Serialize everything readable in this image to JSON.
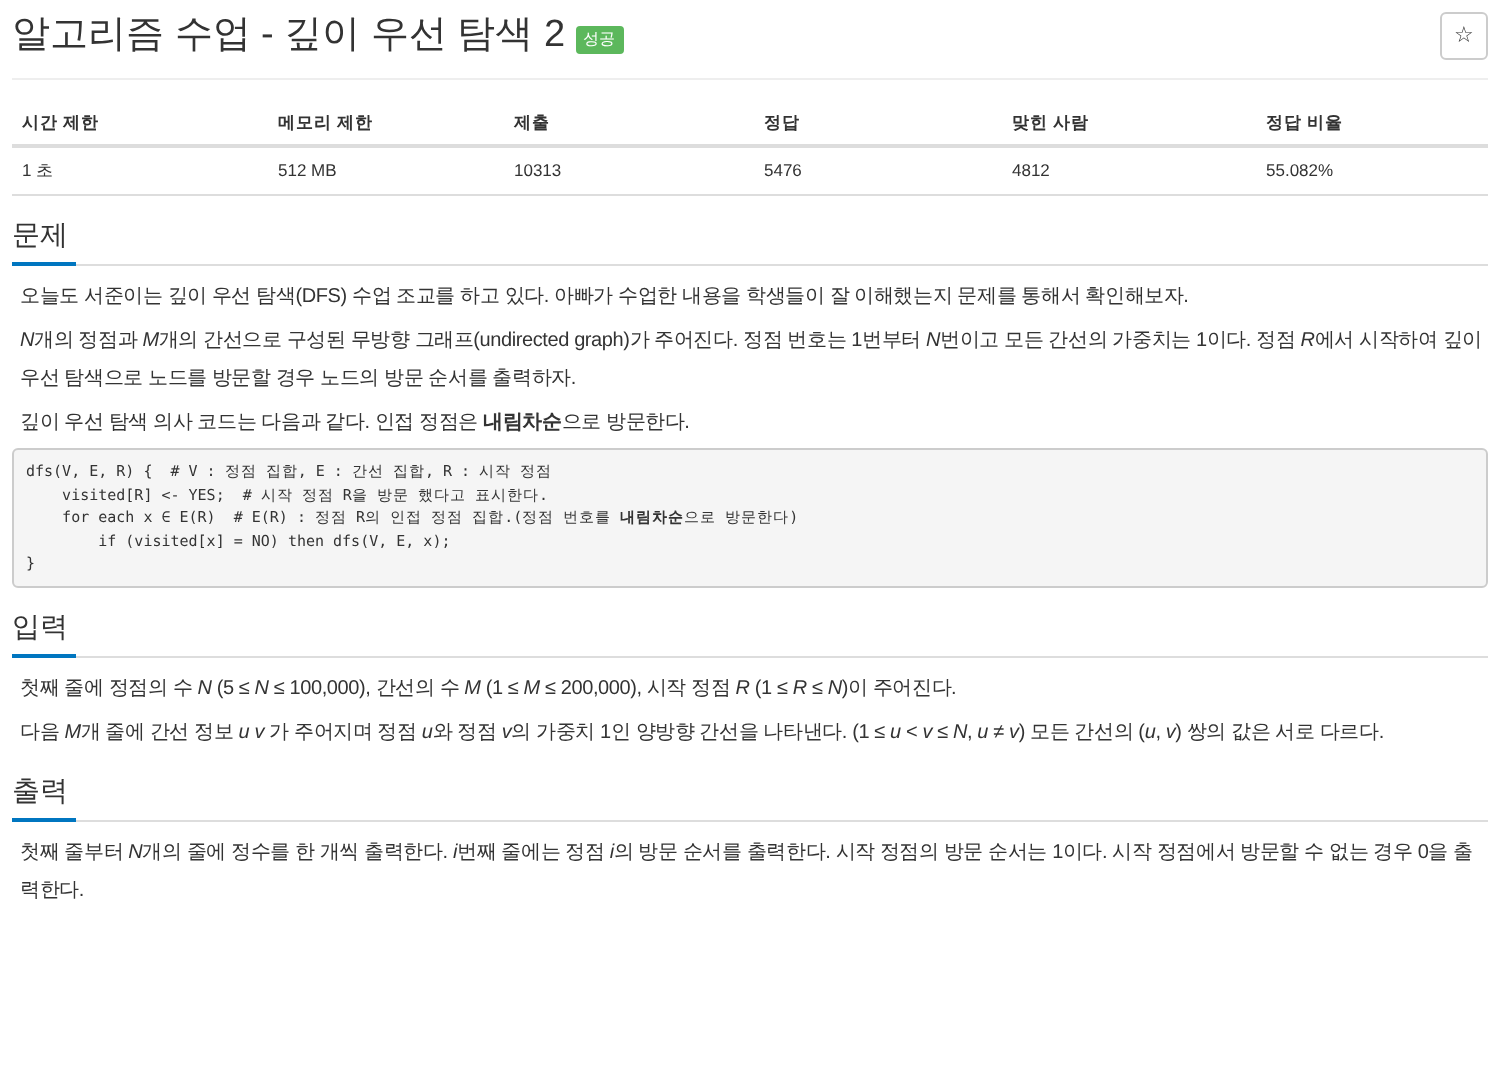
{
  "title": "알고리즘 수업 - 깊이 우선 탐색 2",
  "badge": "성공",
  "star_button": "☆",
  "table": {
    "columns": [
      "시간 제한",
      "메모리 제한",
      "제출",
      "정답",
      "맞힌 사람",
      "정답 비율"
    ],
    "rows": [
      [
        "1 초",
        "512 MB",
        "10313",
        "5476",
        "4812",
        "55.082%"
      ]
    ]
  },
  "sections": [
    {
      "heading": "문제",
      "blocks": [
        {
          "kind": "text",
          "runs": [
            {
              "text": "오늘도 서준이는 깊이 우선 탐색(DFS) 수업 조교를 하고 있다. 아빠가 수업한 내용을 학생들이 잘 이해했는지 문제를 통해서 확인해보자."
            }
          ]
        },
        {
          "kind": "text",
          "runs": [
            {
              "text": "N",
              "italic": true
            },
            {
              "text": "개의 정점과 "
            },
            {
              "text": "M",
              "italic": true
            },
            {
              "text": "개의 간선으로 구성된 무방향 그래프(undirected graph)가 주어진다. 정점 번호는 1번부터 "
            },
            {
              "text": "N",
              "italic": true
            },
            {
              "text": "번이고 모든 간선의 가중치는 1이다. 정점 "
            },
            {
              "text": "R",
              "italic": true
            },
            {
              "text": "에서 시작하여 깊이 우선 탐색으로 노드를 방문할 경우 노드의 방문 순서를 출력하자."
            }
          ]
        },
        {
          "kind": "text",
          "runs": [
            {
              "text": "깊이 우선 탐색 의사 코드는 다음과 같다. 인접 정점은 "
            },
            {
              "text": "내림차순",
              "bold": true
            },
            {
              "text": "으로 방문한다."
            }
          ]
        },
        {
          "kind": "code",
          "lines": [
            "dfs(V, E, R) {  # V : 정점 집합, E : 간선 집합, R : 시작 정점",
            "    visited[R] <- YES;  # 시작 정점 R을 방문 했다고 표시한다.",
            "    for each x ∈ E(R)  # E(R) : 정점 R의 인접 정점 집합.(정점 번호를 **내림차순**으로 방문한다)",
            "        if (visited[x] = NO) then dfs(V, E, x);",
            "}"
          ]
        }
      ]
    },
    {
      "heading": "입력",
      "blocks": [
        {
          "kind": "text",
          "runs": [
            {
              "text": "첫째 줄에 정점의 수 "
            },
            {
              "text": "N",
              "italic": true
            },
            {
              "text": " (5 ≤ "
            },
            {
              "text": "N",
              "italic": true
            },
            {
              "text": " ≤ 100,000), 간선의 수 "
            },
            {
              "text": "M",
              "italic": true
            },
            {
              "text": " (1 ≤ "
            },
            {
              "text": "M",
              "italic": true
            },
            {
              "text": " ≤ 200,000), 시작 정점 "
            },
            {
              "text": "R",
              "italic": true
            },
            {
              "text": " (1 ≤ "
            },
            {
              "text": "R",
              "italic": true
            },
            {
              "text": " ≤ "
            },
            {
              "text": "N",
              "italic": true
            },
            {
              "text": ")이 주어진다."
            }
          ]
        },
        {
          "kind": "text",
          "runs": [
            {
              "text": "다음 "
            },
            {
              "text": "M",
              "italic": true
            },
            {
              "text": "개 줄에 간선 정보 "
            },
            {
              "text": "u v",
              "italic": true
            },
            {
              "text": " 가 주어지며 정점 "
            },
            {
              "text": "u",
              "italic": true
            },
            {
              "text": "와 정점 "
            },
            {
              "text": "v",
              "italic": true
            },
            {
              "text": "의 가중치 1인 양방향 간선을 나타낸다. (1 ≤ "
            },
            {
              "text": "u",
              "italic": true
            },
            {
              "text": " < "
            },
            {
              "text": "v",
              "italic": true
            },
            {
              "text": " ≤ "
            },
            {
              "text": "N",
              "italic": true
            },
            {
              "text": ", "
            },
            {
              "text": "u",
              "italic": true
            },
            {
              "text": " ≠ "
            },
            {
              "text": "v",
              "italic": true
            },
            {
              "text": ") 모든 간선의 ("
            },
            {
              "text": "u",
              "italic": true
            },
            {
              "text": ", "
            },
            {
              "text": "v",
              "italic": true
            },
            {
              "text": ") 쌍의 값은 서로 다르다."
            }
          ]
        }
      ]
    },
    {
      "heading": "출력",
      "blocks": [
        {
          "kind": "text",
          "runs": [
            {
              "text": "첫째 줄부터 "
            },
            {
              "text": "N",
              "italic": true
            },
            {
              "text": "개의 줄에 정수를 한 개씩 출력한다. "
            },
            {
              "text": "i",
              "italic": true
            },
            {
              "text": "번째 줄에는 정점 "
            },
            {
              "text": "i",
              "italic": true
            },
            {
              "text": "의 방문 순서를 출력한다. 시작 정점의 방문 순서는 1이다. 시작 정점에서 방문할 수 없는 경우 0을 출력한다."
            }
          ]
        }
      ]
    }
  ]
}
